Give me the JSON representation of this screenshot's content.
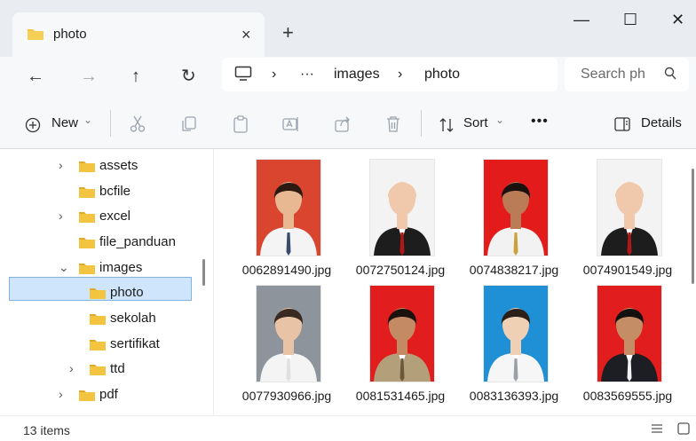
{
  "tab": {
    "title": "photo",
    "close_glyph": "×"
  },
  "newtab_glyph": "+",
  "window": {
    "minimize_glyph": "—",
    "maximize_glyph": "☐",
    "close_glyph": "✕"
  },
  "nav": {
    "back": "←",
    "forward": "→",
    "up": "↑",
    "refresh": "↻"
  },
  "breadcrumb": {
    "sep": "›",
    "more": "···",
    "items": [
      "images",
      "photo"
    ]
  },
  "search": {
    "placeholder": "Search ph"
  },
  "commands": {
    "new_label": "New",
    "sort_label": "Sort",
    "more": "•••",
    "details_label": "Details",
    "caret": "⌄"
  },
  "tree": [
    {
      "label": "assets",
      "chevron": "›"
    },
    {
      "label": "bcfile",
      "chevron": ""
    },
    {
      "label": "excel",
      "chevron": "›"
    },
    {
      "label": "file_panduan",
      "chevron": ""
    },
    {
      "label": "images",
      "chevron": "⌄"
    },
    {
      "label": "photo",
      "chevron": "",
      "selected": true
    },
    {
      "label": "sekolah",
      "chevron": ""
    },
    {
      "label": "sertifikat",
      "chevron": ""
    },
    {
      "label": "ttd",
      "chevron": "›"
    },
    {
      "label": "pdf",
      "chevron": "›"
    }
  ],
  "files": [
    {
      "name": "0062891490.jpg",
      "bg": "#d9452f",
      "skin": "#e7b892",
      "hair": "#2a1a12",
      "top": "#f4f4f4",
      "accent": "#3a4a6a"
    },
    {
      "name": "0072750124.jpg",
      "bg": "#f3f3f3",
      "skin": "#f0c9ad",
      "hair": "#f0c9ad",
      "top": "#1d1d1d",
      "accent": "#b01818"
    },
    {
      "name": "0074838217.jpg",
      "bg": "#e41b1b",
      "skin": "#b97c56",
      "hair": "#1b1210",
      "top": "#f2f2f2",
      "accent": "#c9a23a"
    },
    {
      "name": "0074901549.jpg",
      "bg": "#f3f3f3",
      "skin": "#f0c9ad",
      "hair": "#f0c9ad",
      "top": "#1d1d1d",
      "accent": "#b01818"
    },
    {
      "name": "0077930966.jpg",
      "bg": "#8d949b",
      "skin": "#e9c3a6",
      "hair": "#3a2a22",
      "top": "#f4f4f4",
      "accent": "#e0e0e0"
    },
    {
      "name": "0081531465.jpg",
      "bg": "#e21d1d",
      "skin": "#c48a64",
      "hair": "#1b1210",
      "top": "#b3a07a",
      "accent": "#6b5a3a"
    },
    {
      "name": "0083136393.jpg",
      "bg": "#1f8fd6",
      "skin": "#efd0b4",
      "hair": "#2c1f18",
      "top": "#f6f6f6",
      "accent": "#9aa0a6"
    },
    {
      "name": "0083569555.jpg",
      "bg": "#e21d1d",
      "skin": "#c58d66",
      "hair": "#141010",
      "top": "#1d1d24",
      "accent": "#f2f2f2"
    }
  ],
  "status": {
    "item_count": "13 items"
  },
  "colors": {
    "folder": "#f3c43f",
    "folder_dark": "#e0a92b",
    "selection": "#cfe5fb"
  }
}
